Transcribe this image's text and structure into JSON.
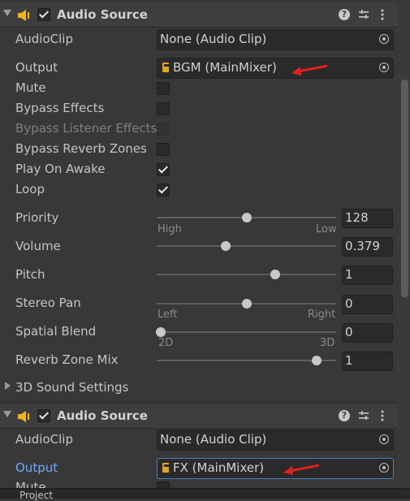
{
  "component1": {
    "title": "Audio Source",
    "audio_clip": {
      "label": "AudioClip",
      "value": "None (Audio Clip)"
    },
    "output": {
      "label": "Output",
      "value": "BGM (MainMixer)"
    },
    "mute": {
      "label": "Mute",
      "checked": false
    },
    "bypass_effects": {
      "label": "Bypass Effects",
      "checked": false
    },
    "bypass_listener_effects": {
      "label": "Bypass Listener Effects",
      "checked": false,
      "disabled": true
    },
    "bypass_reverb_zones": {
      "label": "Bypass Reverb Zones",
      "checked": false
    },
    "play_on_awake": {
      "label": "Play On Awake",
      "checked": true
    },
    "loop": {
      "label": "Loop",
      "checked": true
    },
    "priority": {
      "label": "Priority",
      "value": "128",
      "min_label": "High",
      "max_label": "Low",
      "fraction": 0.5
    },
    "volume": {
      "label": "Volume",
      "value": "0.379",
      "fraction": 0.379
    },
    "pitch": {
      "label": "Pitch",
      "value": "1",
      "fraction": 0.667
    },
    "stereo_pan": {
      "label": "Stereo Pan",
      "value": "0",
      "min_label": "Left",
      "max_label": "Right",
      "fraction": 0.5
    },
    "spatial_blend": {
      "label": "Spatial Blend",
      "value": "0",
      "min_label": "2D",
      "max_label": "3D",
      "fraction": 0.0
    },
    "reverb_zone_mix": {
      "label": "Reverb Zone Mix",
      "value": "1",
      "fraction": 0.909
    },
    "sound_settings": {
      "label": "3D Sound Settings"
    }
  },
  "component2": {
    "title": "Audio Source",
    "audio_clip": {
      "label": "AudioClip",
      "value": "None (Audio Clip)"
    },
    "output": {
      "label": "Output",
      "value": "FX (MainMixer)"
    },
    "mute": {
      "label": "Mute"
    }
  },
  "bottom_tab": {
    "label": "Project"
  },
  "colors": {
    "annotation_arrow": "#e02020",
    "mixer_icon": "#e3a524",
    "speaker_icon": "#f2b31d",
    "output_active_label": "#6fa8ff"
  },
  "icons": [
    "foldout-arrow-icon",
    "speaker-icon",
    "help-icon",
    "presets-icon",
    "kebab-menu-icon",
    "object-picker-icon",
    "audio-mixer-icon"
  ]
}
